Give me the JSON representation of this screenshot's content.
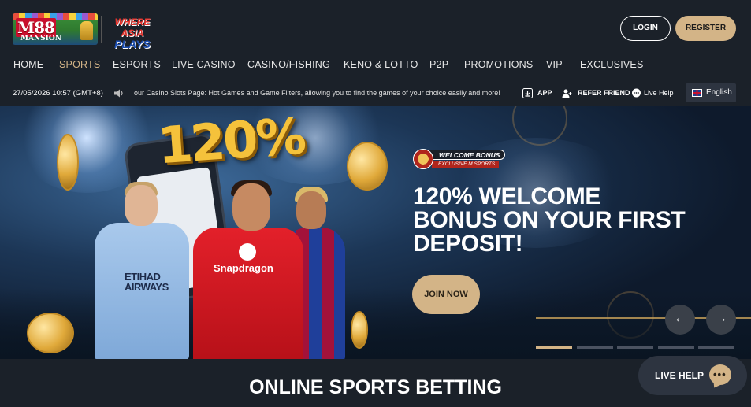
{
  "header": {
    "logo_brand": "M88",
    "logo_sub": "MANSION",
    "logo_tagline_line1": "WHERE ASIA",
    "logo_tagline_line2": "PLAYS",
    "login_label": "LOGIN",
    "register_label": "REGISTER"
  },
  "nav": {
    "items": [
      {
        "label": "HOME"
      },
      {
        "label": "SPORTS"
      },
      {
        "label": "ESPORTS"
      },
      {
        "label": "LIVE CASINO"
      },
      {
        "label": "CASINO/FISHING"
      },
      {
        "label": "KENO & LOTTO"
      },
      {
        "label": "P2P"
      },
      {
        "label": "PROMOTIONS"
      },
      {
        "label": "VIP"
      },
      {
        "label": "EXCLUSIVES"
      }
    ],
    "active": "SPORTS"
  },
  "infobar": {
    "datetime": "27/05/2026 10:57 (GMT+8)",
    "ticker": "our Casino Slots Page: Hot Games and Game Filters, allowing you to find the games of your choice easily and more!",
    "app_label": "APP",
    "refer_label": "REFER FRIEND",
    "livehelp_label": "Live Help",
    "language": "English"
  },
  "hero": {
    "promo_graphic": "120%",
    "player1_sponsor": "ETIHAD AIRWAYS",
    "player2_sponsor": "Snapdragon",
    "badge_top": "WELCOME BONUS",
    "badge_bottom": "EXCLUSIVE M SPORTS",
    "title": "120% WELCOME BONUS ON YOUR FIRST DEPOSIT!",
    "cta_label": "JOIN NOW",
    "prev_icon": "←",
    "next_icon": "→",
    "slides_total": 5,
    "slide_active": 1
  },
  "colors": {
    "background": "#1b2129",
    "accent_gold": "#d3b487",
    "active_nav": "#d3b487"
  },
  "live_help_widget": {
    "label": "LIVE HELP",
    "icon": "chat-bubble-icon"
  },
  "section": {
    "title": "ONLINE SPORTS BETTING"
  }
}
